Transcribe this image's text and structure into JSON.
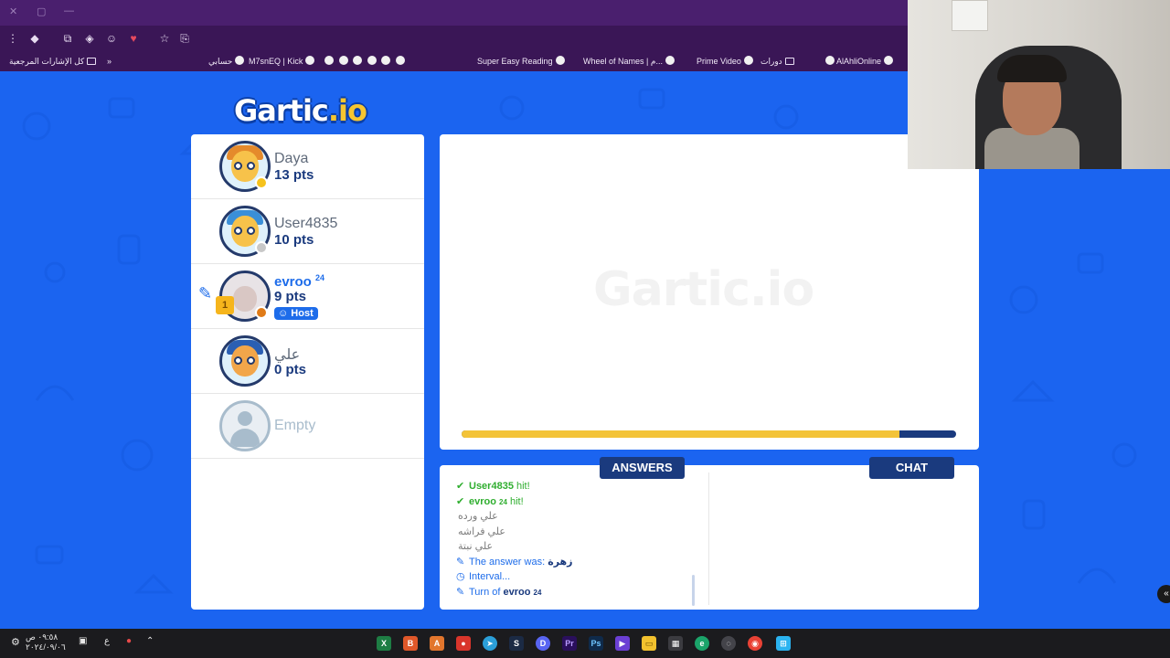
{
  "browser": {
    "window_controls": [
      "✕",
      "▢",
      "—"
    ],
    "bookmarks": [
      {
        "label": "كل الإشارات المرجعية",
        "type": "folder"
      },
      {
        "label": "حسابي",
        "type": "site"
      },
      {
        "label": "M7snEQ | Kick",
        "type": "site"
      },
      {
        "label": "Super Easy Reading",
        "type": "site"
      },
      {
        "label": "Wheel of Names | م...",
        "type": "site"
      },
      {
        "label": "Prime Video",
        "type": "site"
      },
      {
        "label": "دورات",
        "type": "folder"
      },
      {
        "label": "AlAhliOnline",
        "type": "site"
      }
    ],
    "more_bookmarks": "»"
  },
  "logo": {
    "text": "Gartic",
    "suffix": ".io"
  },
  "players": [
    {
      "name": "Daya",
      "points": "13 pts",
      "status_color": "#f6c21c",
      "hair": "#e58a2b",
      "skin": "#f7c24a"
    },
    {
      "name": "User4835",
      "points": "10 pts",
      "status_color": "#c8c8c8",
      "hair": "#3a8fd8",
      "skin": "#f7c24a"
    },
    {
      "name": "evroo",
      "name_sup": "24",
      "points": "9 pts",
      "status_color": "#e07b17",
      "host_label": "Host",
      "rank": "1",
      "is_drawing": true
    },
    {
      "name": "علي",
      "points": "0 pts",
      "status_color": "#1d6cea",
      "hair": "#2a5fb3",
      "skin": "#f2a64a"
    },
    {
      "name": "Empty",
      "points": "",
      "empty": true
    }
  ],
  "canvas": {
    "watermark": "Gartic.io",
    "timer_fraction": 0.89
  },
  "answers": {
    "title": "ANSWERS",
    "lines": [
      {
        "kind": "hit",
        "icon": "check-icon",
        "user": "User4835",
        "text": "hit!"
      },
      {
        "kind": "hit",
        "icon": "check-icon",
        "user": "evroo",
        "user_sup": "24",
        "text": "hit!"
      },
      {
        "kind": "guess",
        "text": "علي ورده"
      },
      {
        "kind": "guess",
        "text": "علي فراشه"
      },
      {
        "kind": "guess",
        "text": "علي نبتة"
      },
      {
        "kind": "sys",
        "icon": "pencil-icon",
        "text": "The answer was:",
        "value": "زهرة"
      },
      {
        "kind": "sys",
        "icon": "clock-icon",
        "text": "Interval..."
      },
      {
        "kind": "sys",
        "icon": "pencil-icon",
        "text": "Turn of",
        "value": "evroo",
        "value_sup": "24"
      }
    ]
  },
  "chat": {
    "title": "CHAT"
  },
  "taskbar": {
    "clock_time": "٠٩:٥٨ ص",
    "clock_date": "٢٠٢٤/٠٩/٠٦",
    "lang": "ع"
  }
}
